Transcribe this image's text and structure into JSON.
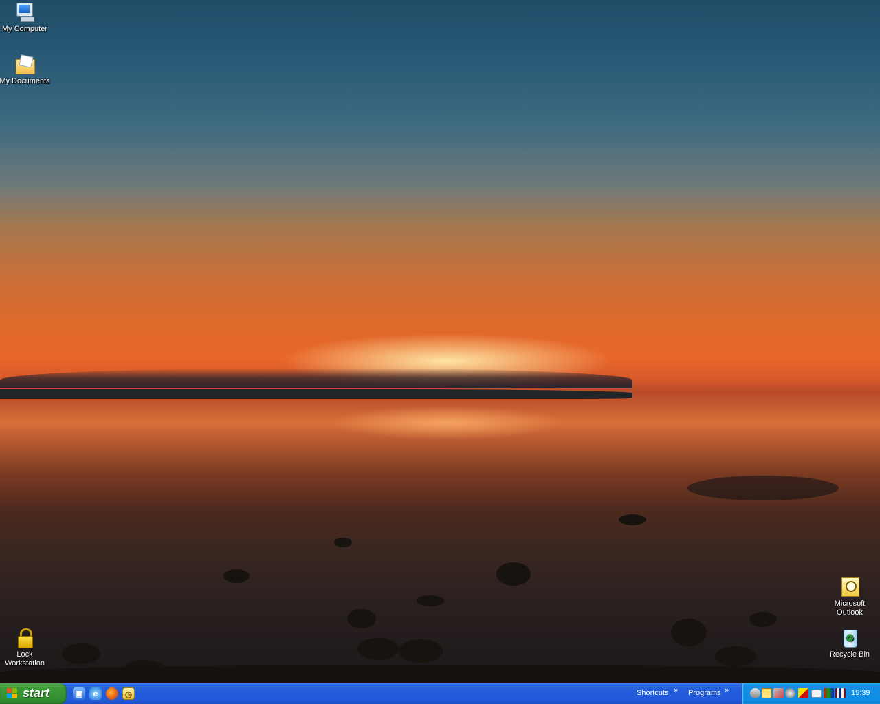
{
  "desktop": {
    "icons": [
      {
        "id": "my-computer",
        "label": "My Computer",
        "icon": "computer-icon"
      },
      {
        "id": "my-documents",
        "label": "My Documents",
        "icon": "documents-folder-icon"
      },
      {
        "id": "lock-workstation",
        "label_line1": "Lock",
        "label_line2": "Workstation",
        "icon": "padlock-icon"
      },
      {
        "id": "microsoft-outlook",
        "label_line1": "Microsoft",
        "label_line2": "Outlook",
        "icon": "outlook-icon"
      },
      {
        "id": "recycle-bin",
        "label": "Recycle Bin",
        "icon": "recycle-bin-icon"
      }
    ],
    "wallpaper": "sunset-over-tidal-flats"
  },
  "taskbar": {
    "start_label": "start",
    "quick_launch": [
      {
        "icon": "show-desktop-icon"
      },
      {
        "icon": "internet-explorer-icon"
      },
      {
        "icon": "firefox-icon"
      },
      {
        "icon": "outlook-icon"
      }
    ],
    "toolbars": {
      "shortcuts": "Shortcuts",
      "programs": "Programs",
      "chevron": "»"
    },
    "tray_icons": [
      "network-icon",
      "outlook-reminder-icon",
      "tools-icon",
      "security-icon",
      "zonealarm-icon",
      "mail-icon",
      "color-picker-icon",
      "books-icon",
      "ime-icon"
    ],
    "clock": "15:39"
  },
  "colors": {
    "taskbar_blue": "#245edb",
    "start_green": "#349030",
    "tray_blue": "#0f8ee3"
  }
}
